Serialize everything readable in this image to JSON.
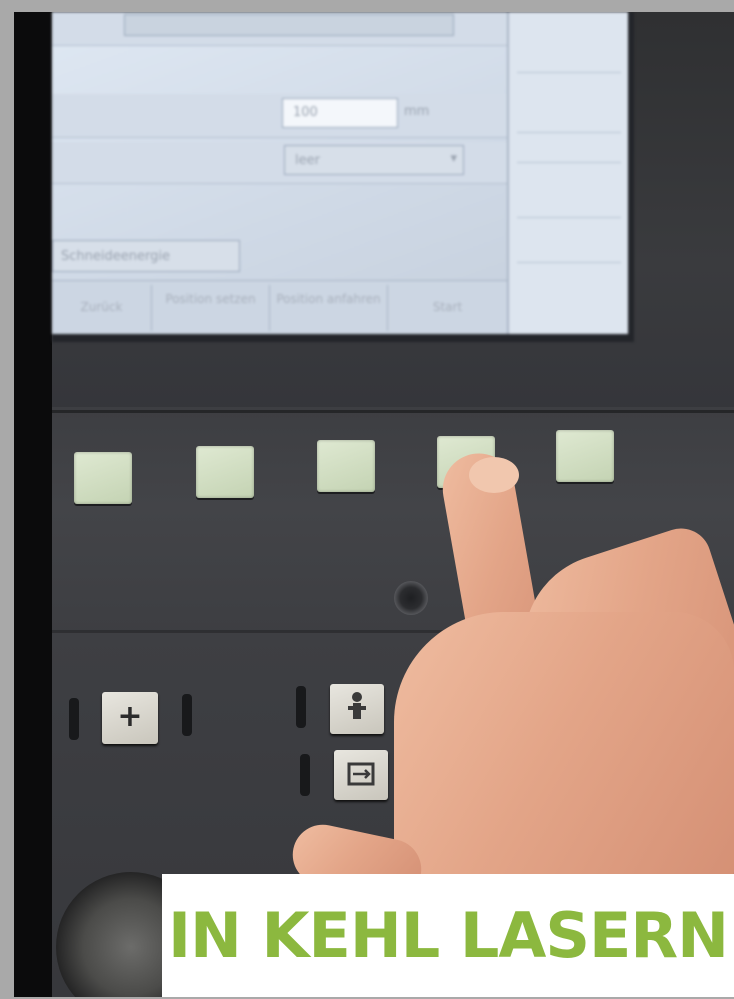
{
  "caption": {
    "text": "IN KEHL LASERN",
    "text_color": "#8cb83f",
    "background_color": "#ffffff"
  },
  "screen": {
    "field_value": "100",
    "field_unit": "mm",
    "dropdown_value": "leer",
    "status_text": "Schneideenergie",
    "softkeys": [
      "Zurück",
      "Position setzen",
      "Position anfahren",
      "Start"
    ]
  },
  "controls": {
    "plus_key": "+",
    "person_key_icon": "person-icon",
    "jog_key_icon": "jog-icon"
  }
}
